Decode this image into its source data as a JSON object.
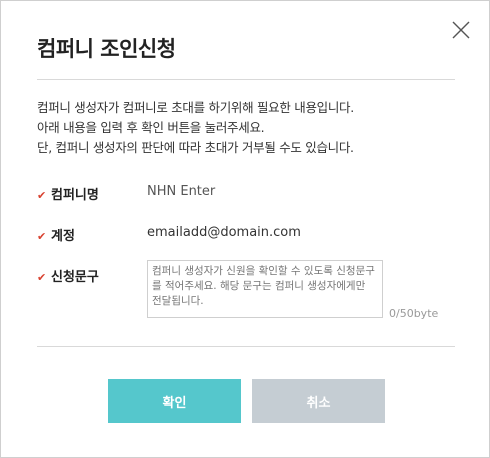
{
  "dialog": {
    "title": "컴퍼니 조인신청",
    "description": [
      "컴퍼니 생성자가 컴퍼니로 초대를 하기위해 필요한 내용입니다.",
      "아래 내용을 입력 후 확인 버튼을 눌러주세요.",
      "단, 컴퍼니 생성자의 판단에 따라 초대가 거부될 수도 있습니다."
    ],
    "required_mark": "✔",
    "company_label": "컴퍼니명",
    "company_value": "NHN Enter",
    "account_label": "계정",
    "account_value": "emailadd@domain.com",
    "message_label": "신청문구",
    "message_placeholder": "컴퍼니 생성자가 신원을 확인할 수 있도록 신청문구를 적어주세요. 해당 문구는 컴퍼니 생성자에게만 전달됩니다.",
    "message_counter": "0/50byte",
    "confirm_label": "확인",
    "cancel_label": "취소"
  },
  "colors": {
    "accent": "#55c7cc",
    "cancel": "#c5cdd3",
    "required_mark": "#d8412f"
  },
  "icons": {
    "close": "close-icon",
    "required": "check-icon"
  }
}
